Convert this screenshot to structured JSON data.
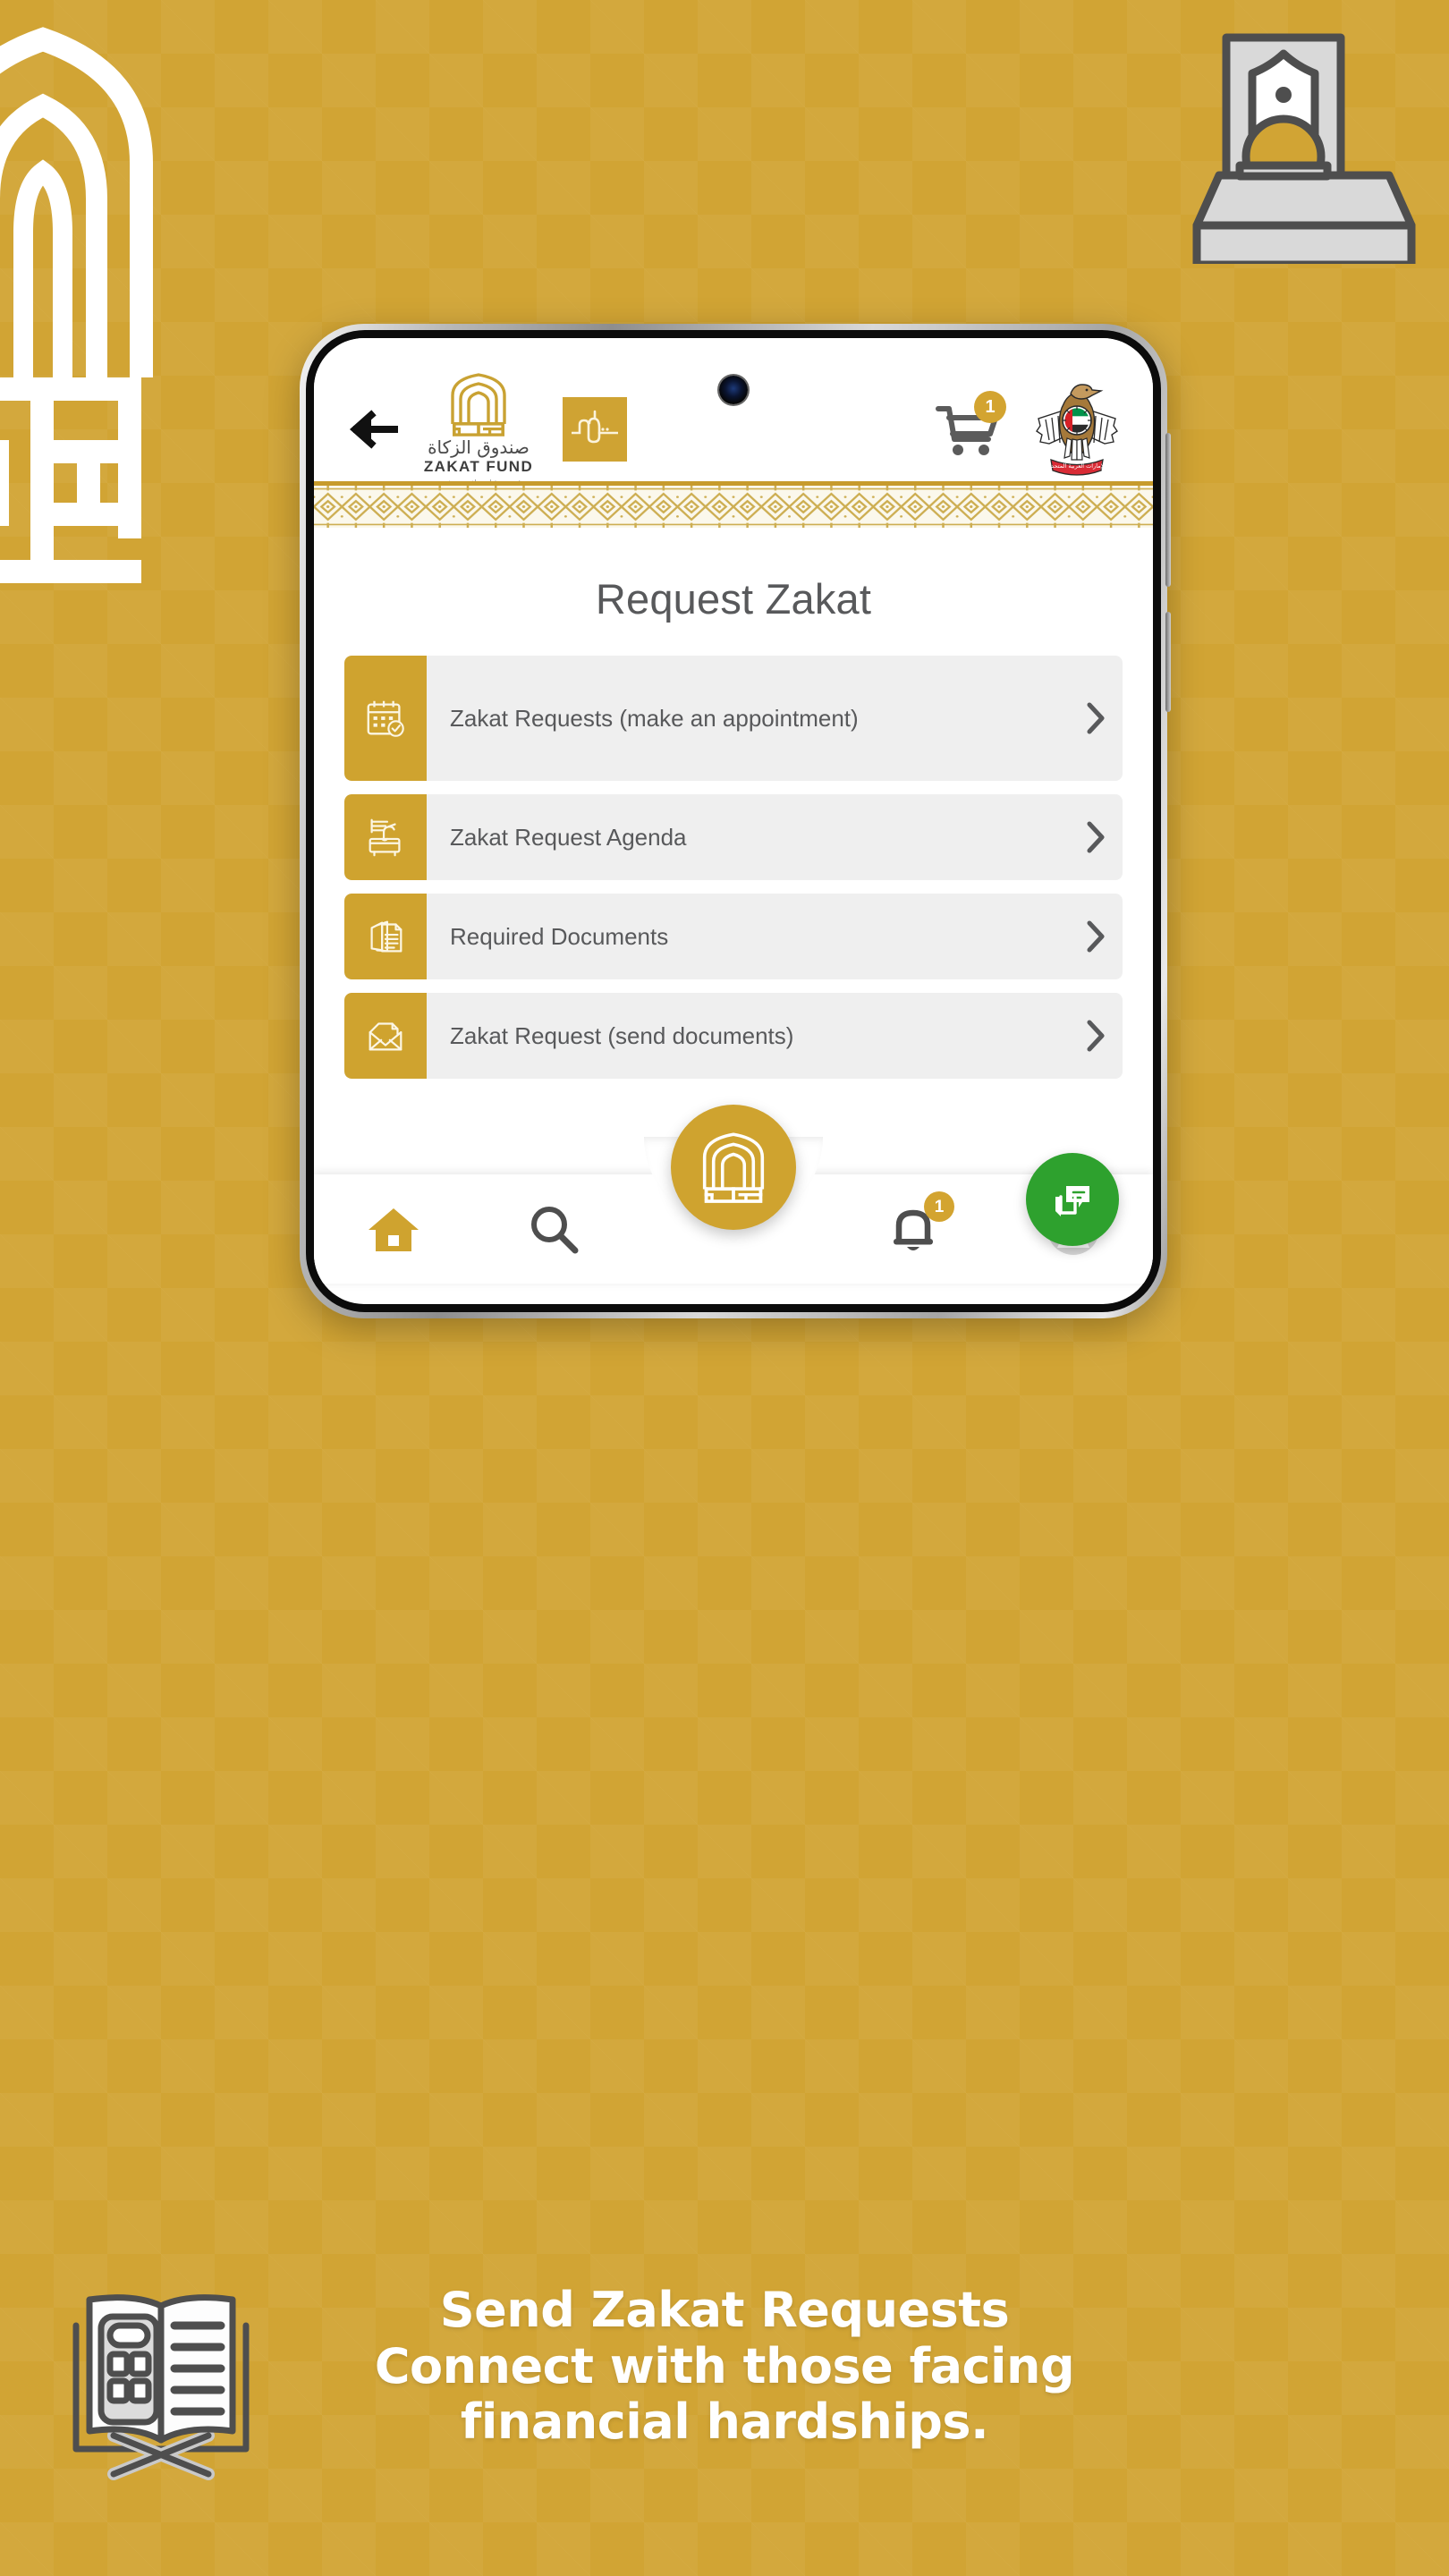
{
  "background": {
    "color": "#D1A434",
    "pattern": "checkered-squares"
  },
  "decor": {
    "left_logo_icon": "zakat-fund-arch-monogram",
    "top_right_icon": "donation-box-with-banknote",
    "bottom_left_icon": "open-book-with-calculator"
  },
  "phone": {
    "camera_icon": "front-camera",
    "side_buttons": [
      "volume-button",
      "power-button"
    ]
  },
  "header": {
    "back_icon": "back-arrow-icon",
    "logo": {
      "arch_icon": "zakat-fund-arch-icon",
      "arabic_name": "صندوق الزكاة",
      "english_name": "ZAKAT FUND",
      "tagline": "رؤية مستقبلية . لفريضة شرعية"
    },
    "secondary_logo": {
      "icon": "nafis-wordmark-icon",
      "bg_color": "#CFA333"
    },
    "cart": {
      "icon": "shopping-cart-icon",
      "badge_count": "1",
      "badge_color": "#D3A430"
    },
    "emblem": {
      "icon": "uae-federal-emblem-icon",
      "ribbon_text": "الإمارات العربية المتحدة"
    }
  },
  "pattern_band": {
    "icon": "arabic-geometric-pattern",
    "top_rule_color": "#C79B2C",
    "bg_color": "#FBF8EC"
  },
  "main": {
    "title": "Request Zakat",
    "menu": [
      {
        "label": "Zakat Requests (make an appointment)",
        "icon": "calendar-check-icon",
        "chevron": "chevron-right-icon",
        "tall": true
      },
      {
        "label": "Zakat Request Agenda",
        "icon": "hand-donation-box-icon",
        "chevron": "chevron-right-icon",
        "tall": false
      },
      {
        "label": "Required Documents",
        "icon": "documents-stack-icon",
        "chevron": "chevron-right-icon",
        "tall": false
      },
      {
        "label": "Zakat Request (send documents)",
        "icon": "envelope-document-icon",
        "chevron": "chevron-right-icon",
        "tall": false
      }
    ]
  },
  "chat_fab": {
    "icon": "chat-bubbles-icon",
    "color": "#2EA12E"
  },
  "bottom_nav": {
    "items": [
      {
        "icon": "home-icon",
        "active": true
      },
      {
        "icon": "search-icon",
        "active": false
      },
      {
        "icon": "notification-bell-icon",
        "active": false,
        "badge_count": "1"
      },
      {
        "icon": "user-profile-icon",
        "active": false
      }
    ],
    "center_fab": {
      "icon": "zakat-fund-arch-icon",
      "color": "#CFA32F"
    }
  },
  "caption": {
    "line1": "Send Zakat Requests",
    "line2": "Connect with those facing",
    "line3": "financial hardships.",
    "color": "#FFFFFF"
  }
}
